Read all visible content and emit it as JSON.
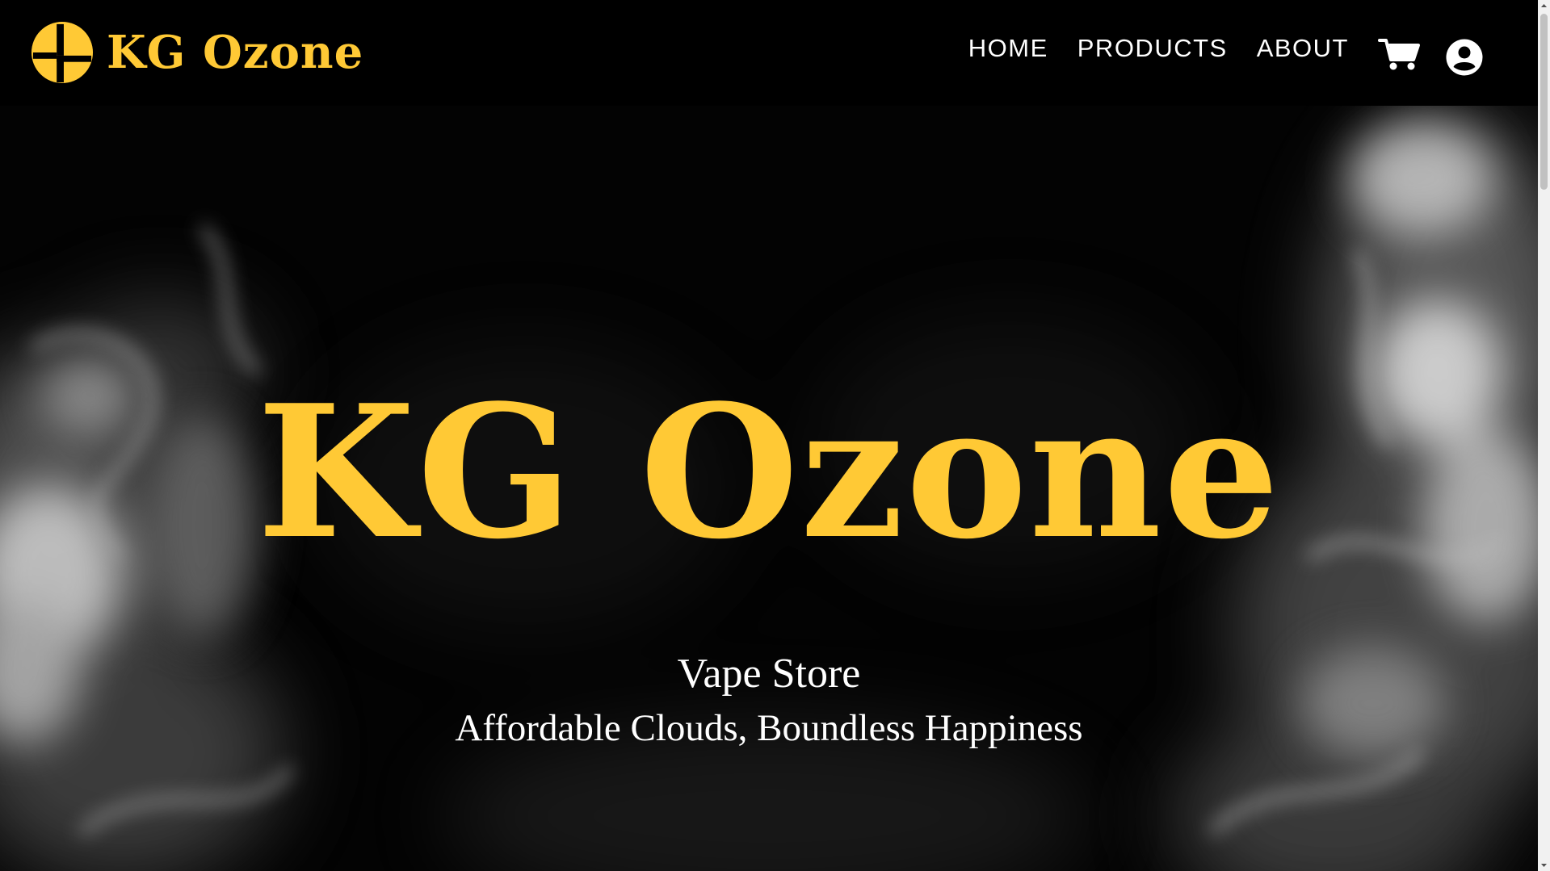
{
  "navbar": {
    "brand_name": "KG Ozone",
    "brand_logo_icon": "kg-ozone-logo-icon",
    "links": [
      {
        "label": "HOME"
      },
      {
        "label": "PRODUCTS"
      },
      {
        "label": "ABOUT"
      }
    ],
    "cart_icon": "shopping-cart-icon",
    "account_icon": "user-account-icon"
  },
  "hero": {
    "title": "KG Ozone",
    "subtitle": "Vape Store",
    "tagline": "Affordable Clouds, Boundless Happiness",
    "background": "smoke-background"
  },
  "colors": {
    "brand": "#FFC935",
    "background": "#000000",
    "text": "#FFFFFF"
  }
}
